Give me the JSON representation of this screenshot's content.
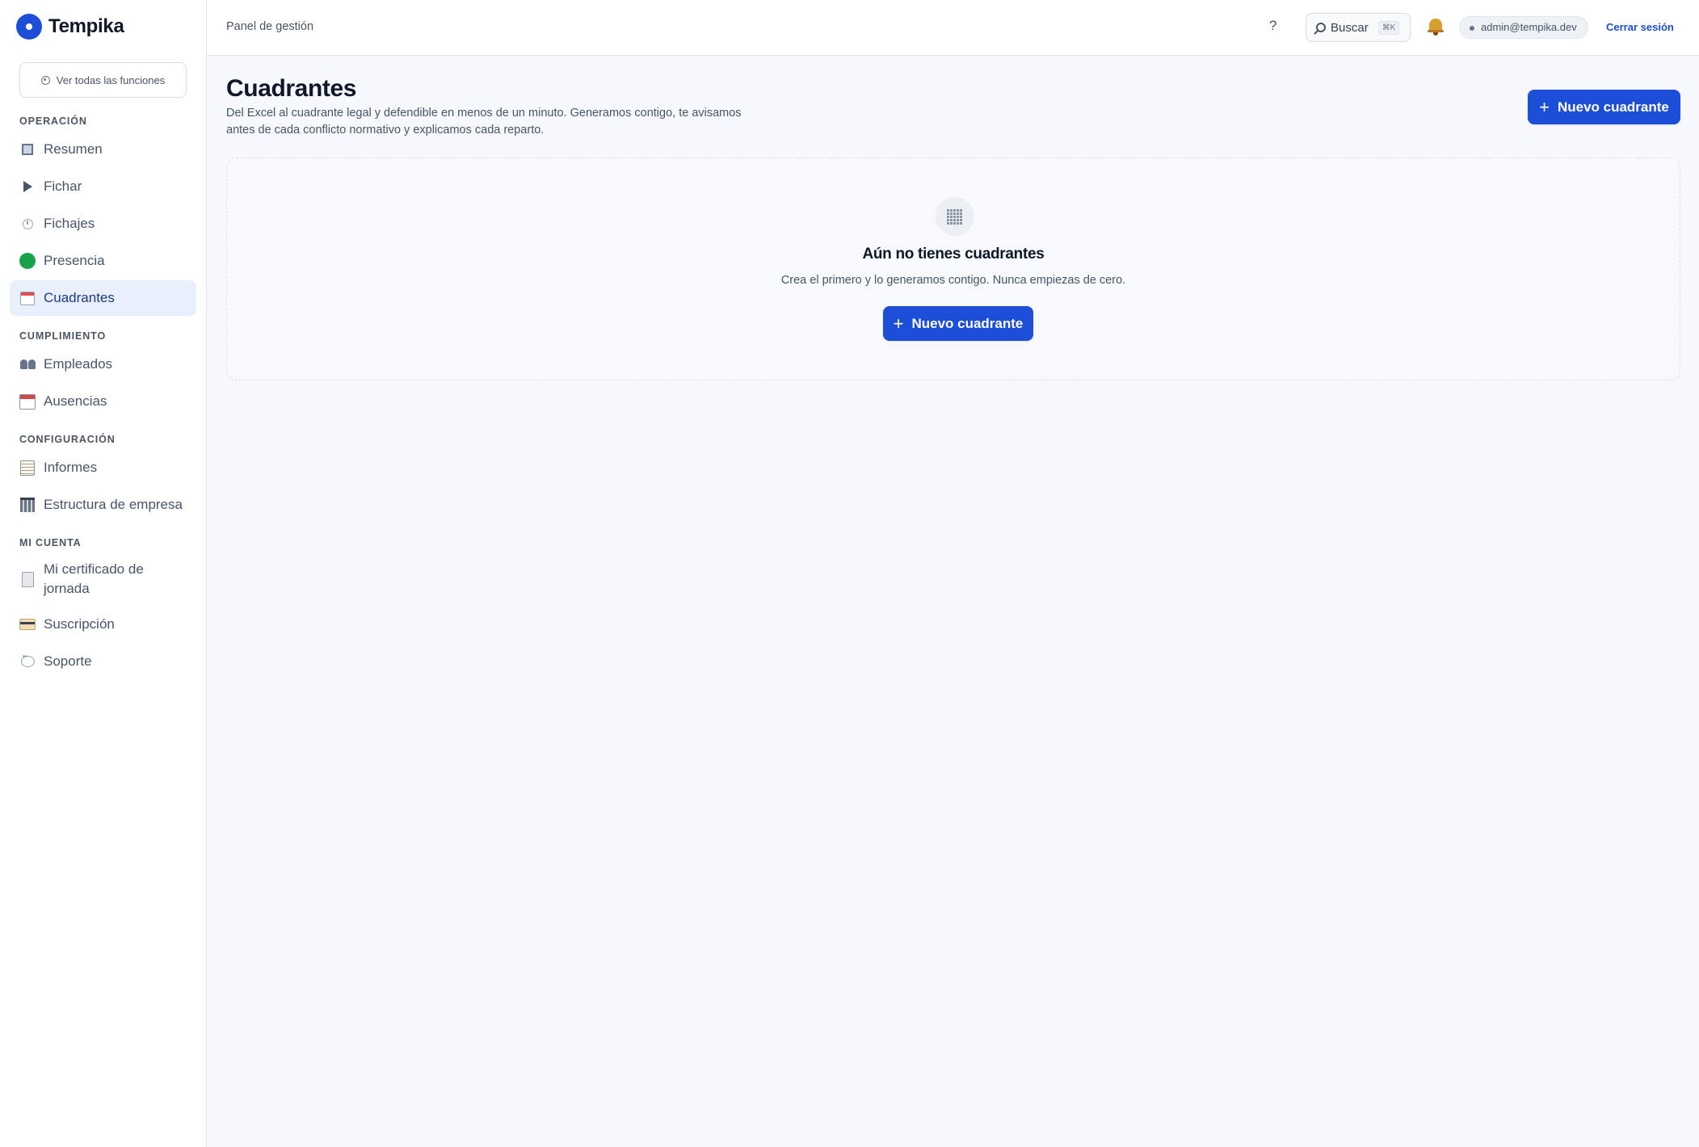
{
  "brand": {
    "name": "Tempika"
  },
  "sidebar": {
    "all_features_label": "Ver todas las funciones",
    "sections": [
      {
        "title": "OPERACIÓN",
        "items": [
          {
            "label": "Resumen",
            "icon": "square-icon"
          },
          {
            "label": "Fichar",
            "icon": "play-icon"
          },
          {
            "label": "Fichajes",
            "icon": "clock-icon"
          },
          {
            "label": "Presencia",
            "icon": "green-circle-icon"
          },
          {
            "label": "Cuadrantes",
            "icon": "calendar-icon",
            "active": true
          }
        ]
      },
      {
        "title": "CUMPLIMIENTO",
        "items": [
          {
            "label": "Empleados",
            "icon": "people-icon"
          },
          {
            "label": "Ausencias",
            "icon": "calendar-17-icon"
          }
        ]
      },
      {
        "title": "CONFIGURACIÓN",
        "items": [
          {
            "label": "Informes",
            "icon": "ledger-icon"
          },
          {
            "label": "Estructura de empresa",
            "icon": "building-icon"
          }
        ]
      },
      {
        "title": "MI CUENTA",
        "items": [
          {
            "label": "Mi certificado de jornada",
            "icon": "document-icon"
          },
          {
            "label": "Suscripción",
            "icon": "credit-card-icon"
          },
          {
            "label": "Soporte",
            "icon": "speech-bubble-icon"
          }
        ]
      }
    ]
  },
  "topbar": {
    "breadcrumb": "Panel de gestión",
    "help_label": "?",
    "search_label": "Buscar",
    "search_shortcut": "⌘K",
    "user_email": "admin@tempika.dev",
    "logout_label": "Cerrar sesión"
  },
  "page": {
    "title": "Cuadrantes",
    "description": "Del Excel al cuadrante legal y defendible en menos de un minuto. Generamos contigo, te avisamos antes de cada conflicto normativo y explicamos cada reparto.",
    "new_button_label": "Nuevo cuadrante"
  },
  "empty_state": {
    "title": "Aún no tienes cuadrantes",
    "subtitle": "Crea el primero y lo generamos contigo. Nunca empiezas de cero.",
    "button_label": "Nuevo cuadrante"
  },
  "colors": {
    "primary": "#1d4ed8",
    "active_bg": "#e9effb",
    "presence_green": "#16a34a"
  }
}
